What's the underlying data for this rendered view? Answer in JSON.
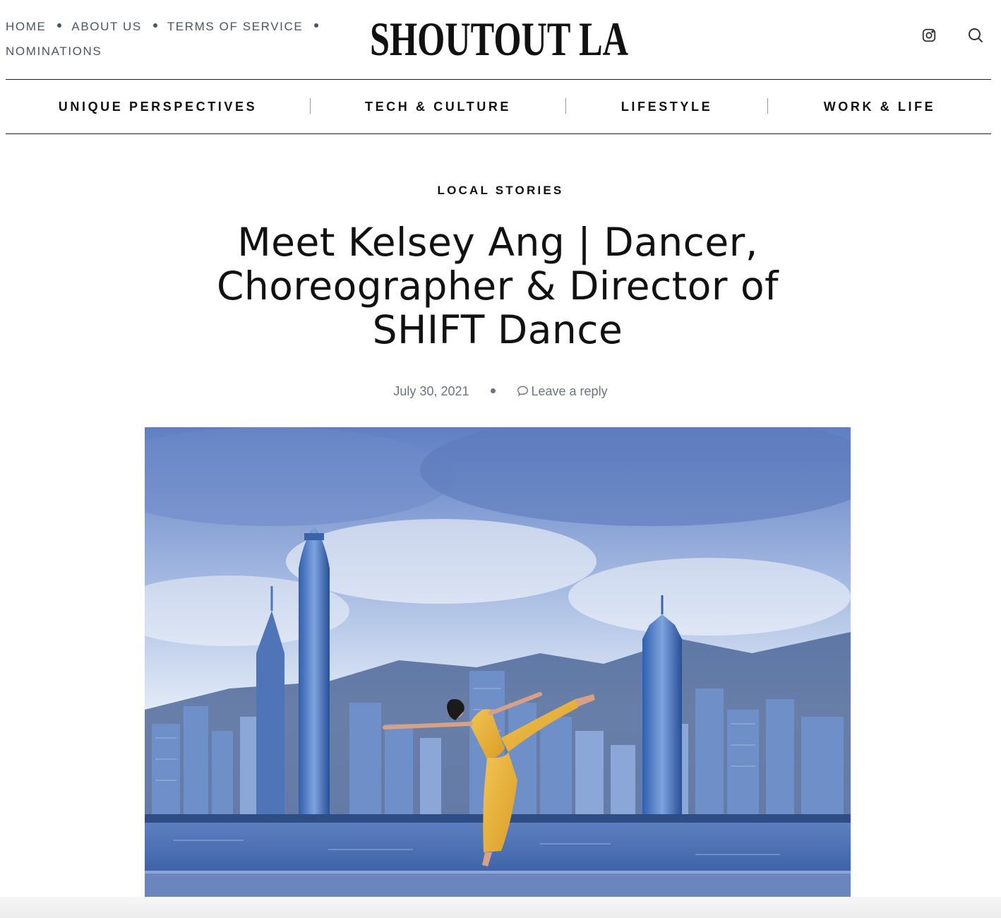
{
  "top_nav": {
    "items": [
      "HOME",
      "ABOUT US",
      "TERMS OF SERVICE",
      "NOMINATIONS"
    ]
  },
  "brand": {
    "logo_text": "SHOUTOUT LA"
  },
  "header_icons": [
    "instagram-icon",
    "search-icon"
  ],
  "category_nav": {
    "items": [
      "UNIQUE PERSPECTIVES",
      "TECH & CULTURE",
      "LIFESTYLE",
      "WORK & LIFE"
    ]
  },
  "article": {
    "category": "LOCAL STORIES",
    "title": "Meet Kelsey Ang | Dancer, Choreographer & Director of SHIFT Dance",
    "date": "July 30, 2021",
    "reply_label": "Leave a reply"
  },
  "colors": {
    "text": "#111111",
    "muted": "#6b7280",
    "dress": "#e8b23a",
    "sky": "#6f8fcf",
    "water": "#4f73b8"
  }
}
